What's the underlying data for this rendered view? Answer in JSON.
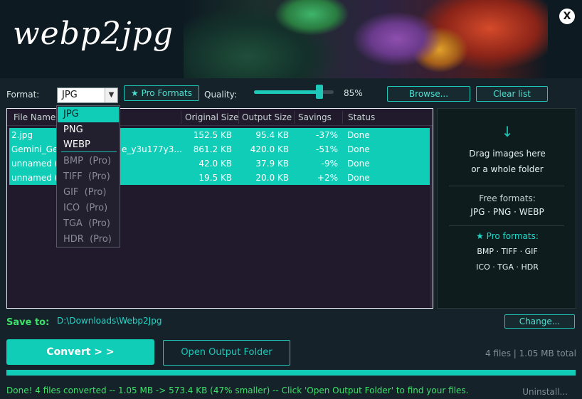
{
  "app": {
    "title": "webp2jpg",
    "close_label": "X"
  },
  "toolbar": {
    "format_label": "Format:",
    "format_value": "JPG",
    "pro_button": "★ Pro Formats",
    "quality_label": "Quality:",
    "quality_value": "85%",
    "quality_fraction": 0.85,
    "browse_button": "Browse...",
    "clear_button": "Clear list"
  },
  "dropdown": {
    "selected": "JPG",
    "free_options": [
      "JPG",
      "PNG",
      "WEBP"
    ],
    "pro_options": [
      {
        "name": "BMP",
        "tag": "(Pro)"
      },
      {
        "name": "TIFF",
        "tag": "(Pro)"
      },
      {
        "name": "GIF",
        "tag": "(Pro)"
      },
      {
        "name": "ICO",
        "tag": "(Pro)"
      },
      {
        "name": "TGA",
        "tag": "(Pro)"
      },
      {
        "name": "HDR",
        "tag": "(Pro)"
      }
    ]
  },
  "table": {
    "columns": [
      "File Name",
      "Original Size",
      "Output Size",
      "Savings",
      "Status"
    ],
    "rows": [
      {
        "name": "2.jpg",
        "original": "152.5 KB",
        "output": "95.4 KB",
        "savings": "-37%",
        "status": "Done"
      },
      {
        "name": "Gemini_Ge",
        "name_tail": "e_y3u177y3...",
        "original": "861.2 KB",
        "output": "420.0 KB",
        "savings": "-51%",
        "status": "Done"
      },
      {
        "name": "unnamed (",
        "original": "42.0 KB",
        "output": "37.9 KB",
        "savings": "-9%",
        "status": "Done"
      },
      {
        "name": "unnamed (",
        "original": "19.5 KB",
        "output": "20.0 KB",
        "savings": "+2%",
        "status": "Done"
      }
    ]
  },
  "dropzone": {
    "arrow": "↓",
    "line1": "Drag images here",
    "line2": "or a whole folder",
    "free_title": "Free formats:",
    "free_list": "JPG · PNG · WEBP",
    "pro_title": "★  Pro formats:",
    "pro_list1": "BMP · TIFF · GIF",
    "pro_list2": "ICO · TGA · HDR"
  },
  "save": {
    "label": "Save to:",
    "path": "D:\\Downloads\\Webp2Jpg",
    "change_button": "Change..."
  },
  "actions": {
    "convert_button": "Convert   > >",
    "open_folder_button": "Open Output Folder",
    "total": "4 files  |  1.05 MB total"
  },
  "progress": {
    "fraction": 1.0
  },
  "status": {
    "message": "Done!  4 files converted  --  1.05 MB -> 573.4 KB  (47% smaller)  --  Click 'Open Output Folder' to find your files.",
    "uninstall": "Uninstall..."
  },
  "colors": {
    "accent": "#0fcdb7",
    "success": "#3ee06a",
    "panel": "#201a2c"
  }
}
